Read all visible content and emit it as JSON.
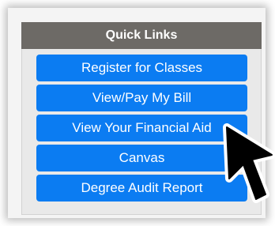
{
  "quick_links": {
    "title": "Quick Links",
    "items": [
      {
        "label": "Register for Classes"
      },
      {
        "label": "View/Pay My Bill"
      },
      {
        "label": "View Your Financial Aid"
      },
      {
        "label": "Canvas"
      },
      {
        "label": "Degree Audit Report"
      }
    ]
  },
  "colors": {
    "header_bg": "#6d6a66",
    "button_bg": "#0b7cf2",
    "panel_bg": "#e9e9e9"
  },
  "icons": {
    "cursor": "mouse-pointer-icon"
  }
}
